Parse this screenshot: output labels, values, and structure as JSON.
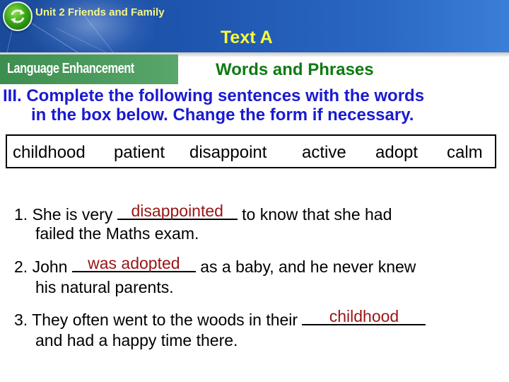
{
  "header": {
    "unit_title": "Unit 2  Friends and Family",
    "text_title": "Text A",
    "logo_icon": "refresh-arrows-icon"
  },
  "banner": {
    "label": "Language Enhancement"
  },
  "section_title": "Words and Phrases",
  "instructions": {
    "line1": "III. Complete the following sentences with the words",
    "line2": "in the box below. Change the form if necessary."
  },
  "word_box": [
    "childhood",
    "patient",
    "disappoint",
    "active",
    "adopt",
    "calm"
  ],
  "questions": [
    {
      "number": "1.",
      "before": "She is very",
      "answer": "disappointed",
      "after": "to know that she had",
      "continuation": "failed the Maths exam."
    },
    {
      "number": "2.",
      "before": "John",
      "answer": "was adopted",
      "after": "as a baby, and he never knew",
      "continuation": "his natural parents."
    },
    {
      "number": "3.",
      "before": "They often went to the woods in their",
      "answer": "childhood",
      "after": "",
      "continuation": "and had a happy time there."
    }
  ],
  "colors": {
    "header_blue": "#1f56b0",
    "unit_title": "#f4f58a",
    "text_title": "#fafa3a",
    "banner_green": "#4a9a5c",
    "section_title": "#0f7a12",
    "instructions": "#1a1ad0",
    "answer": "#9a1414"
  }
}
